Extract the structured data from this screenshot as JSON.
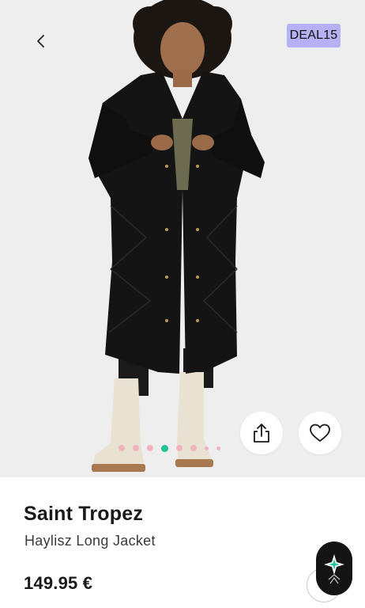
{
  "badge": {
    "label": "DEAL15"
  },
  "product": {
    "brand": "Saint Tropez",
    "name": "Haylisz Long Jacket",
    "price": "149.95 €"
  },
  "gallery": {
    "dots": 8,
    "active_index": 3
  },
  "colors": {
    "badge_bg": "#b5b1f4",
    "dot_inactive": "#f1b4bf",
    "dot_active": "#1fc29b",
    "hero_bg": "#eeeeee"
  },
  "icons": {
    "back": "chevron-left-icon",
    "share": "share-icon",
    "favorite": "heart-icon",
    "assistant": "assistant-logo-icon"
  }
}
